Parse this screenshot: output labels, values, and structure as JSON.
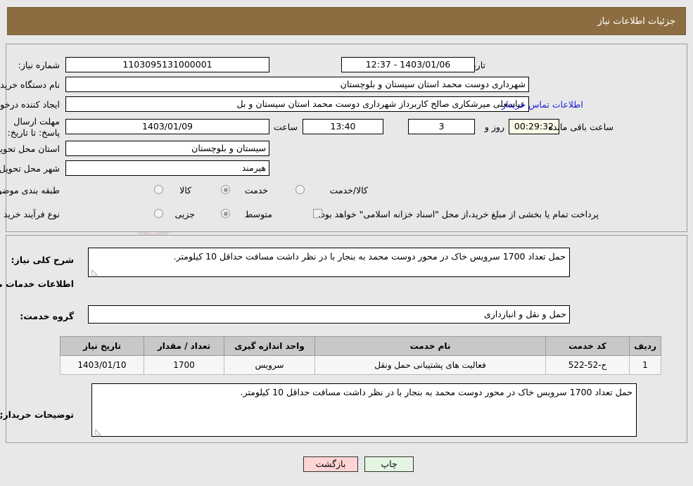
{
  "header": {
    "title": "جزئیات اطلاعات نیاز",
    "bar_color": "#8c6d41"
  },
  "top_form": {
    "need_number_label": "شماره نیاز:",
    "need_number_value": "1103095131000001",
    "announce_label": "تاریخ و ساعت اعلان عمومی:",
    "announce_value": "1403/01/06 - 12:37",
    "buyer_org_label": "نام دستگاه خریدار:",
    "buyer_org_value": "شهرداری دوست محمد استان سیستان و بلوچستان",
    "requester_label": "ایجاد کننده درخواست:",
    "requester_value": "عباسعلی میرشکاری صالح کاربرداز شهرداری دوست محمد استان سیستان و بل",
    "buyer_contact_link": "اطلاعات تماس خریدار",
    "deadline_label": "مهلت ارسال پاسخ: تا تاریخ:",
    "deadline_date": "1403/01/09",
    "time_label": "ساعت",
    "time_value": "13:40",
    "days_value": "3",
    "days_label": "روز و",
    "countdown_value": "00:29:32",
    "countdown_label": "ساعت باقی مانده",
    "province_label": "استان محل تحویل:",
    "province_value": "سیستان و بلوچستان",
    "city_label": "شهر محل تحویل:",
    "city_value": "هیرمند",
    "category_label": "طبقه بندی موضوعی:",
    "category_options": [
      {
        "label": "کالا",
        "selected": false
      },
      {
        "label": "خدمت",
        "selected": true
      },
      {
        "label": "کالا/خدمت",
        "selected": false
      }
    ],
    "process_label": "نوع فرآیند خرید :",
    "process_options": [
      {
        "label": "جزیی",
        "selected": false
      },
      {
        "label": "متوسط",
        "selected": true
      }
    ],
    "treasury_checkbox_checked": false,
    "treasury_text": "پرداخت تمام یا بخشی از مبلغ خرید،از محل \"اسناد خزانه اسلامی\" خواهد بود."
  },
  "description": {
    "general_need_label": "شرح کلی نیاز:",
    "general_need_value": "حمل تعداد 1700 سرویس خاک در محور دوست محمد به بنجار با در نظر داشت مسافت حداقل 10 کیلومتر.",
    "services_info_title": "اطلاعات خدمات مورد نیاز",
    "service_group_label": "گروه خدمت:",
    "service_group_value": "حمل و نقل و انبارداری",
    "buyer_notes_label": "توضیحات خریدار;",
    "buyer_notes_value": "حمل تعداد 1700 سرویس خاک در محور دوست محمد به بنجار با در نظر داشت مسافت حداقل 10 کیلومتر."
  },
  "table": {
    "columns": [
      "ردیف",
      "کد خدمت",
      "نام خدمت",
      "واحد اندازه گیری",
      "تعداد / مقدار",
      "تاریخ نیاز"
    ],
    "rows": [
      {
        "row": "1",
        "code": "ح-52-522",
        "name": "فعالیت های پشتیبانی حمل ونقل",
        "unit": "سرویس",
        "quantity": "1700",
        "date": "1403/01/10"
      }
    ]
  },
  "footer": {
    "back_label": "بازگشت",
    "print_label": "چاپ"
  },
  "watermark": {
    "text": "AriaTender.net"
  }
}
